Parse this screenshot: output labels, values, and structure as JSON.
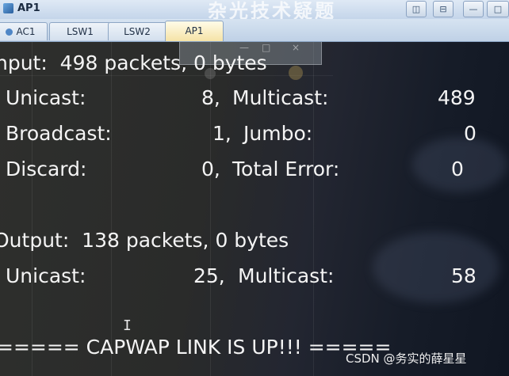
{
  "window": {
    "title": "AP1",
    "watermark_top": "杂光技术疑题",
    "controls": {
      "restore": "◫",
      "a": "⊟",
      "b": "—",
      "c": "□"
    }
  },
  "tabs": [
    {
      "label": "AC1",
      "active": false
    },
    {
      "label": "LSW1",
      "active": false
    },
    {
      "label": "LSW2",
      "active": false
    },
    {
      "label": "AP1",
      "active": true
    }
  ],
  "background_window": {
    "controls": [
      "—",
      "□",
      "×"
    ]
  },
  "console": {
    "input_header": "nput:  498 packets, 0 bytes",
    "input_unicast_label": "Unicast:",
    "input_unicast_value": "8,",
    "input_multicast_label": "Multicast:",
    "input_multicast_value": "489",
    "broadcast_label": "Broadcast:",
    "broadcast_value": "1,",
    "jumbo_label": "Jumbo:",
    "jumbo_value": "0",
    "discard_label": "Discard:",
    "discard_value": "0,",
    "total_error_label": "Total Error:",
    "total_error_value": "0",
    "output_header": "Output:  138 packets, 0 bytes",
    "output_unicast_label": "Unicast:",
    "output_unicast_value": "25,",
    "output_multicast_label": "Multicast:",
    "output_multicast_value": "58",
    "capwap_status": "===== CAPWAP LINK IS UP!!! ====="
  },
  "cursor": "I",
  "watermark": "CSDN @务实的薛星星"
}
